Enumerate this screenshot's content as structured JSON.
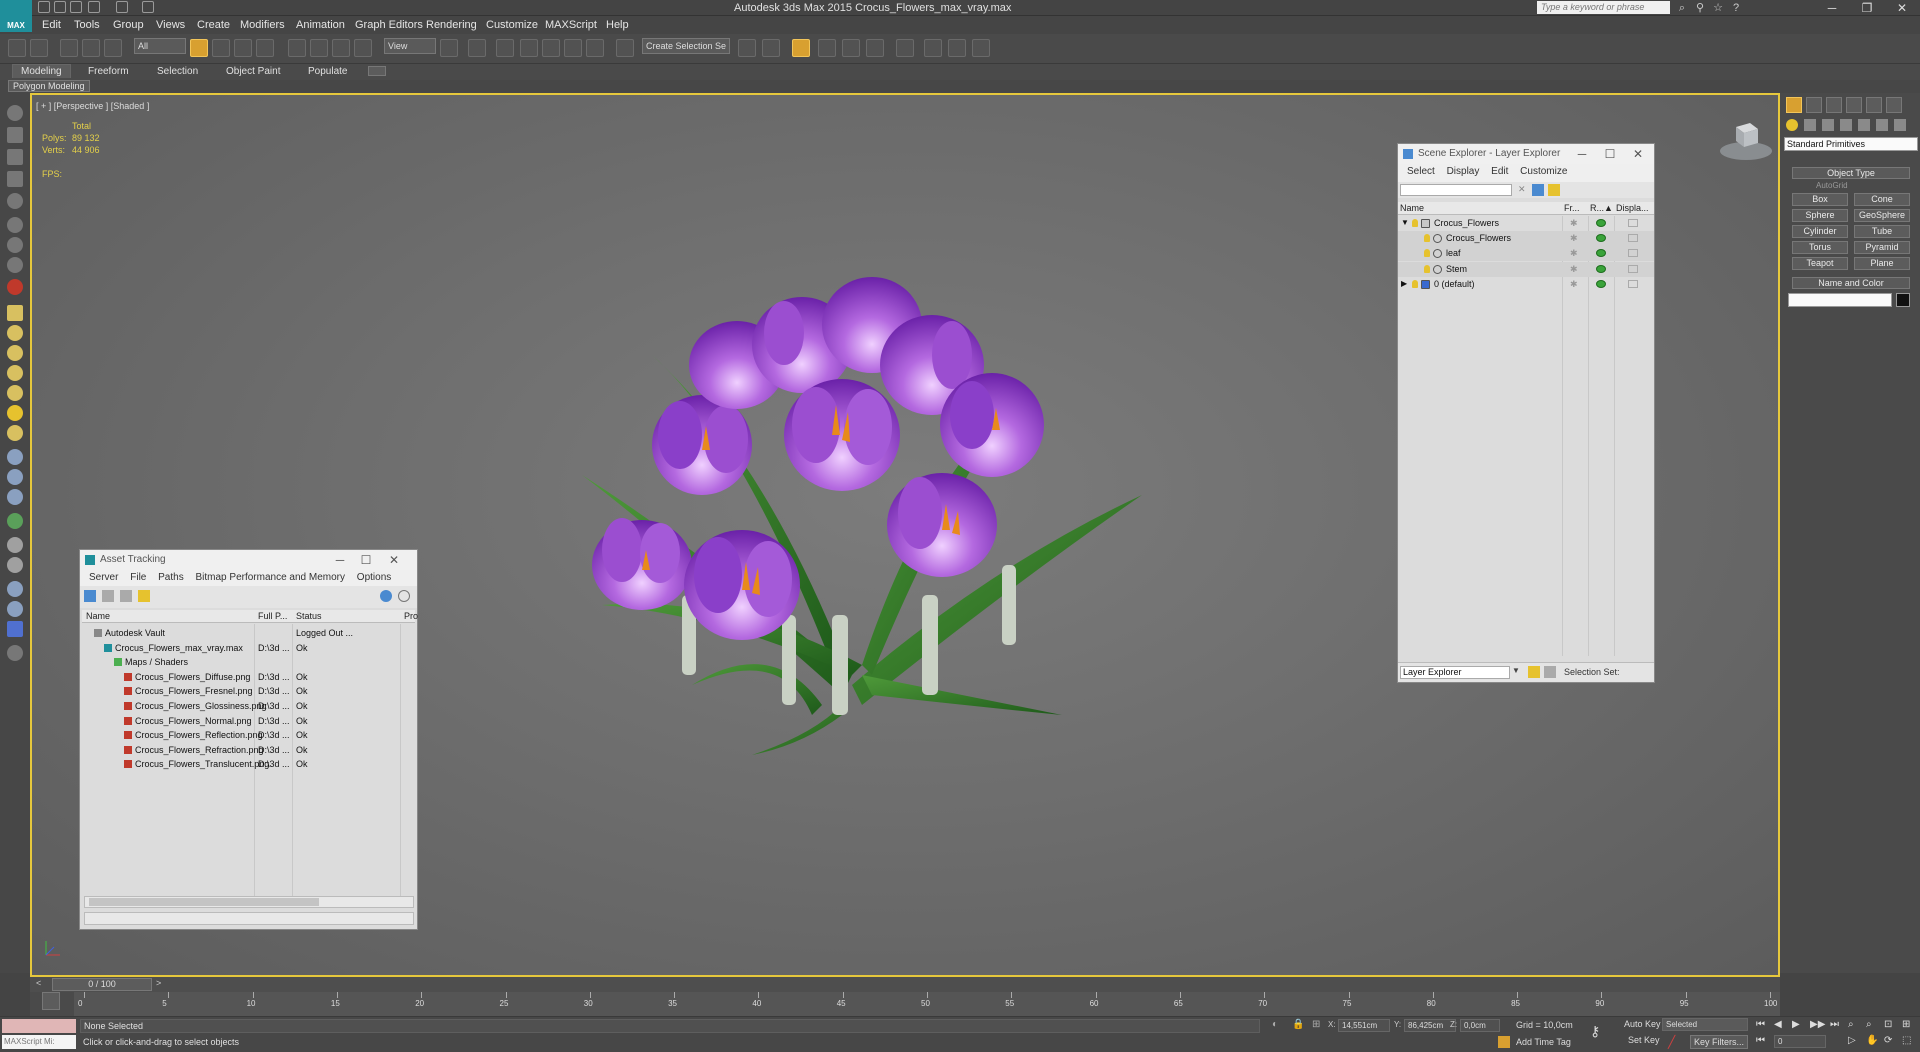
{
  "app": {
    "title": "Autodesk 3ds Max  2015    Crocus_Flowers_max_vray.max",
    "logo_text": "MAX"
  },
  "search": {
    "placeholder": "Type a keyword or phrase"
  },
  "menu": [
    "Edit",
    "Tools",
    "Group",
    "Views",
    "Create",
    "Modifiers",
    "Animation",
    "Graph Editors",
    "Rendering",
    "Customize",
    "MAXScript",
    "Help"
  ],
  "toolbar": {
    "filter": "All",
    "coord": "View",
    "selection_set": "Create Selection Se"
  },
  "ribbon": {
    "tabs": [
      "Modeling",
      "Freeform",
      "Selection",
      "Object Paint",
      "Populate"
    ],
    "active": "Modeling",
    "sub": "Polygon Modeling"
  },
  "viewport": {
    "label": "[ + ] [Perspective ] [Shaded ]",
    "stats": {
      "total": "Total",
      "polys_label": "Polys:",
      "polys": "89 132",
      "verts_label": "Verts:",
      "verts": "44 906",
      "fps_label": "FPS:"
    }
  },
  "scene_explorer": {
    "title": "Scene Explorer - Layer Explorer",
    "menu": [
      "Select",
      "Display",
      "Edit",
      "Customize"
    ],
    "cols": [
      "Name",
      "Fr...",
      "R...▲",
      "Displa..."
    ],
    "rows": [
      {
        "name": "Crocus_Flowers",
        "level": 0,
        "expanded": true
      },
      {
        "name": "Crocus_Flowers",
        "level": 1
      },
      {
        "name": "leaf",
        "level": 1
      },
      {
        "name": "Stem",
        "level": 1
      },
      {
        "name": "0 (default)",
        "level": 0,
        "expanded": false
      }
    ],
    "footer_dropdown": "Layer Explorer",
    "footer_label": "Selection Set:"
  },
  "asset_tracking": {
    "title": "Asset Tracking",
    "menu": [
      "Server",
      "File",
      "Paths",
      "Bitmap Performance and Memory",
      "Options"
    ],
    "cols": [
      "Name",
      "Full P...",
      "Status",
      "Pro"
    ],
    "rows": [
      {
        "name": "Autodesk Vault",
        "path": "",
        "status": "Logged Out ...",
        "level": 0,
        "icon": "vault"
      },
      {
        "name": "Crocus_Flowers_max_vray.max",
        "path": "D:\\3d ...",
        "status": "Ok",
        "level": 1,
        "icon": "max"
      },
      {
        "name": "Maps / Shaders",
        "path": "",
        "status": "",
        "level": 2,
        "icon": "folder"
      },
      {
        "name": "Crocus_Flowers_Diffuse.png",
        "path": "D:\\3d ...",
        "status": "Ok",
        "level": 3,
        "icon": "image"
      },
      {
        "name": "Crocus_Flowers_Fresnel.png",
        "path": "D:\\3d ...",
        "status": "Ok",
        "level": 3,
        "icon": "image"
      },
      {
        "name": "Crocus_Flowers_Glossiness.png",
        "path": "D:\\3d ...",
        "status": "Ok",
        "level": 3,
        "icon": "image"
      },
      {
        "name": "Crocus_Flowers_Normal.png",
        "path": "D:\\3d ...",
        "status": "Ok",
        "level": 3,
        "icon": "image"
      },
      {
        "name": "Crocus_Flowers_Reflection.png",
        "path": "D:\\3d ...",
        "status": "Ok",
        "level": 3,
        "icon": "image"
      },
      {
        "name": "Crocus_Flowers_Refraction.png",
        "path": "D:\\3d ...",
        "status": "Ok",
        "level": 3,
        "icon": "image"
      },
      {
        "name": "Crocus_Flowers_Translucent.png",
        "path": "D:\\3d ...",
        "status": "Ok",
        "level": 3,
        "icon": "image"
      }
    ]
  },
  "command_panel": {
    "dropdown": "Standard Primitives",
    "object_type": "Object Type",
    "autogrid": "AutoGrid",
    "buttons": [
      "Box",
      "Cone",
      "Sphere",
      "GeoSphere",
      "Cylinder",
      "Tube",
      "Torus",
      "Pyramid",
      "Teapot",
      "Plane"
    ],
    "name_color": "Name and Color"
  },
  "timeline": {
    "frame": "0 / 100",
    "ticks": [
      "0",
      "5",
      "10",
      "15",
      "20",
      "25",
      "30",
      "35",
      "40",
      "45",
      "50",
      "55",
      "60",
      "65",
      "70",
      "75",
      "80",
      "85",
      "90",
      "95",
      "100"
    ]
  },
  "status": {
    "selection": "None Selected",
    "prompt": "Click or click-and-drag to select objects",
    "maxscript": "MAXScript Mi:",
    "x_label": "X:",
    "x": "14,551cm",
    "y_label": "Y:",
    "y": "86,425cm",
    "z_label": "Z:",
    "z": "0,0cm",
    "grid": "Grid = 10,0cm",
    "add_time_tag": "Add Time Tag",
    "auto_key": "Auto Key",
    "set_key": "Set Key",
    "selected": "Selected",
    "key_filters": "Key Filters...",
    "frame_field": "0"
  },
  "colors": {
    "viewport_border": "#e6c83c",
    "stats": "#e4d04a",
    "accent": "#1f8f9b",
    "flower": "#8a3fc9"
  }
}
